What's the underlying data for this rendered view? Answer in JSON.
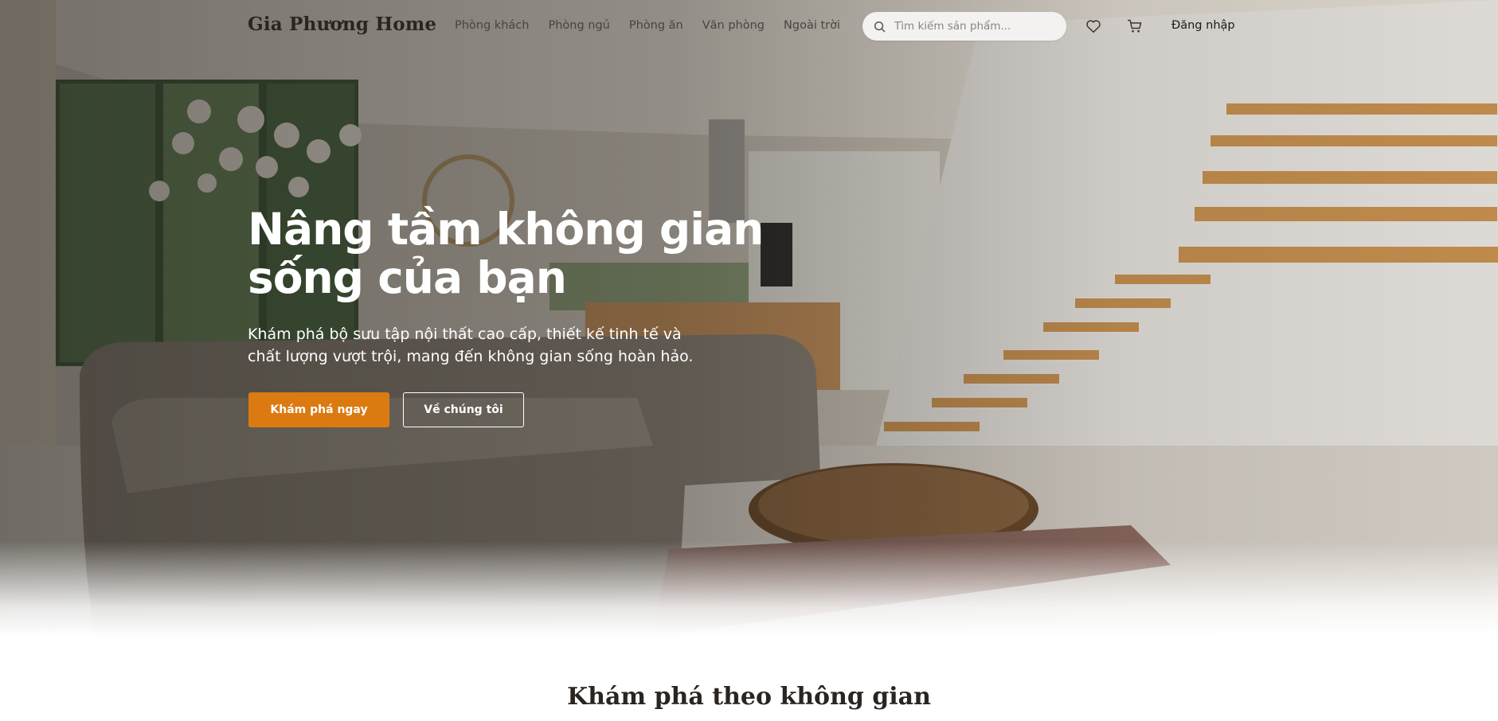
{
  "header": {
    "logo": "Gia Phương Home",
    "nav": [
      "Phòng khách",
      "Phòng ngủ",
      "Phòng ăn",
      "Văn phòng",
      "Ngoài trời"
    ],
    "search_placeholder": "Tìm kiếm sản phẩm...",
    "login_label": "Đăng nhập",
    "icons": {
      "search": "search-icon",
      "wishlist": "heart-icon",
      "cart": "cart-icon"
    }
  },
  "hero": {
    "title_line1": "Nâng tầm không gian",
    "title_line2": "sống của bạn",
    "subtitle_line1": "Khám phá bộ sưu tập nội thất cao cấp, thiết kế tinh tế và",
    "subtitle_line2": "chất lượng vượt trội, mang đến không gian sống hoàn hảo.",
    "primary_button": "Khám phá ngay",
    "secondary_button": "Về chúng tôi"
  },
  "section": {
    "title": "Khám phá theo không gian"
  },
  "colors": {
    "accent": "#dc7a12",
    "text_dark": "#2a2520",
    "search_bg": "#f3f2f0"
  }
}
